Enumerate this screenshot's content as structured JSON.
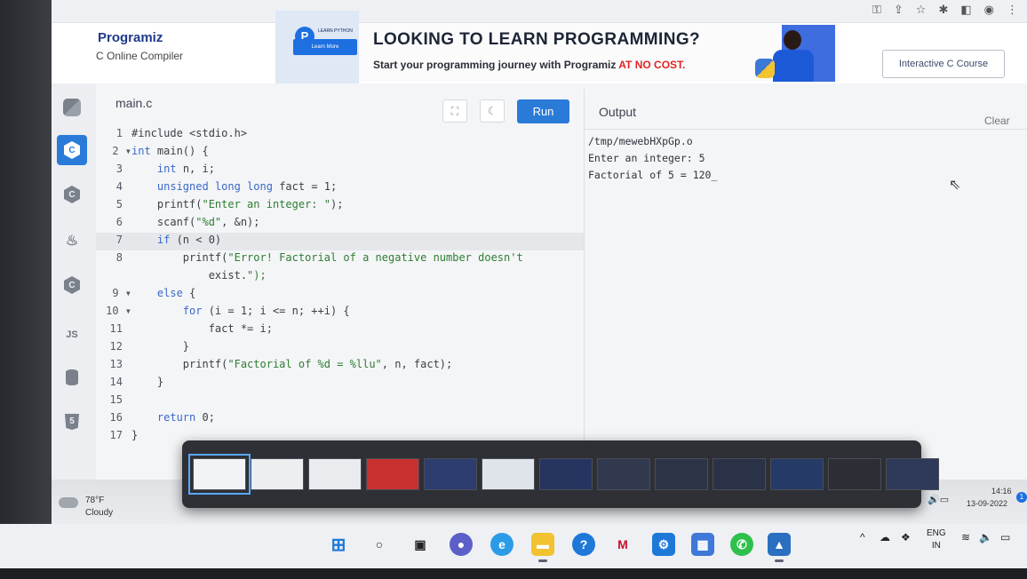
{
  "browser": {
    "toolbar_icons": [
      "key-icon",
      "share-icon",
      "star-icon",
      "extensions-icon",
      "sidebar-icon",
      "profile-icon",
      "menu-icon"
    ]
  },
  "header": {
    "logo": "Programiz",
    "subtitle": "C Online Compiler",
    "ad": {
      "book_text": "LEARN PYTHON",
      "learn_more": "Learn More",
      "title": "LOOKING TO LEARN PROGRAMMING?",
      "subtitle_prefix": "Start your programming journey with Programiz ",
      "subtitle_highlight": "AT NO COST."
    },
    "course_button": "Interactive C Course"
  },
  "rail": {
    "items": [
      {
        "name": "python",
        "label": ""
      },
      {
        "name": "c",
        "label": "C",
        "active": true
      },
      {
        "name": "cpp",
        "label": "C"
      },
      {
        "name": "java",
        "label": "♨"
      },
      {
        "name": "csharp",
        "label": "C"
      },
      {
        "name": "javascript",
        "label": "JS"
      },
      {
        "name": "sql",
        "label": ""
      },
      {
        "name": "html",
        "label": "5"
      }
    ]
  },
  "editor": {
    "file_name": "main.c",
    "run_label": "Run",
    "active_line": 7,
    "lines": [
      {
        "n": "1",
        "text": "#include <stdio.h>"
      },
      {
        "n": "2",
        "fold": true,
        "text": "int main() {"
      },
      {
        "n": "3",
        "text": "    int n, i;"
      },
      {
        "n": "4",
        "text": "    unsigned long long fact = 1;"
      },
      {
        "n": "5",
        "text": "    printf(\"Enter an integer: \");"
      },
      {
        "n": "6",
        "text": "    scanf(\"%d\", &n);"
      },
      {
        "n": "7",
        "text": "    if (n < 0)"
      },
      {
        "n": "8",
        "text": "        printf(\"Error! Factorial of a negative number doesn't"
      },
      {
        "n": "",
        "text": "            exist.\");"
      },
      {
        "n": "9",
        "fold": true,
        "text": "    else {"
      },
      {
        "n": "10",
        "fold": true,
        "text": "        for (i = 1; i <= n; ++i) {"
      },
      {
        "n": "11",
        "text": "            fact *= i;"
      },
      {
        "n": "12",
        "text": "        }"
      },
      {
        "n": "13",
        "text": "        printf(\"Factorial of %d = %llu\", n, fact);"
      },
      {
        "n": "14",
        "text": "    }"
      },
      {
        "n": "15",
        "text": ""
      },
      {
        "n": "16",
        "text": "    return 0;"
      },
      {
        "n": "17",
        "text": "}"
      }
    ]
  },
  "output": {
    "title": "Output",
    "clear_label": "Clear",
    "lines": [
      "/tmp/mewebHXpGp.o",
      "Enter an integer: 5",
      "Factorial of 5 = 120_"
    ]
  },
  "switcher": {
    "thumbnail_count": 13,
    "selected_index": 0
  },
  "taskbar": {
    "weather_temp": "78°F",
    "weather_desc": "Cloudy",
    "lang_top": "IN",
    "time": "14:16",
    "date": "13-09-2022",
    "notification_count": "1",
    "lang_code": "ENG",
    "lang_region": "IN"
  },
  "dock": {
    "icons": [
      "windows-start-icon",
      "search-icon",
      "task-view-icon",
      "teams-chat-icon",
      "edge-icon",
      "file-explorer-icon",
      "help-icon",
      "mcafee-icon",
      "settings-icon",
      "microsoft-store-icon",
      "whatsapp-icon",
      "photos-icon"
    ]
  }
}
